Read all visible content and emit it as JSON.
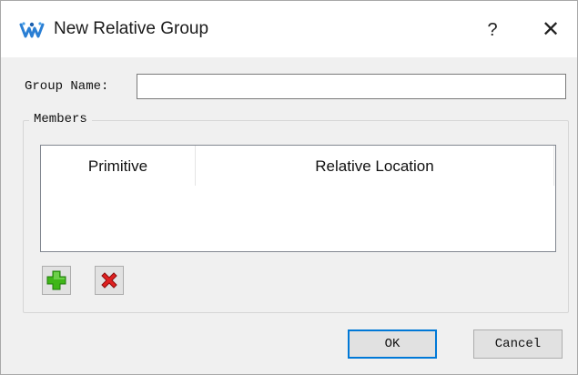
{
  "window": {
    "title": "New Relative Group",
    "help_label": "?",
    "close_label": "✕"
  },
  "form": {
    "group_name_label": "Group Name:",
    "group_name_value": ""
  },
  "members": {
    "legend": "Members",
    "columns": [
      "Primitive",
      "Relative Location"
    ],
    "rows": []
  },
  "buttons": {
    "ok": "OK",
    "cancel": "Cancel"
  },
  "icons": {
    "app": "gowin-logo-icon",
    "add": "green-plus-icon",
    "remove": "red-x-icon"
  },
  "colors": {
    "ok_focus_border": "#0078d7",
    "add_green": "#3fb618",
    "remove_red": "#e02020"
  }
}
